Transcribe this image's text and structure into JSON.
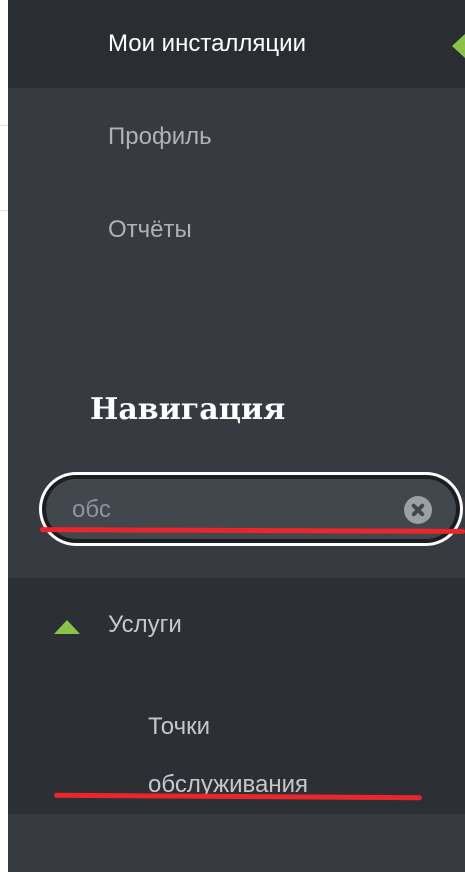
{
  "sidebar": {
    "active_item": {
      "label": "Мои инсталляции",
      "indicator_color": "#8bc34a"
    },
    "items": [
      {
        "label": "Профиль"
      },
      {
        "label": "Отчёты"
      }
    ]
  },
  "navigation": {
    "heading": "Навигация",
    "search": {
      "value": "обс",
      "clear_icon": "clear-icon"
    },
    "tree": {
      "group": {
        "label": "Услуги",
        "expanded": true,
        "toggle_icon": "triangle-up-icon"
      },
      "children": [
        {
          "label_line1": "Точки",
          "label_line2": "обслуживания"
        }
      ]
    }
  },
  "annotations": {
    "color": "#e8262b"
  }
}
